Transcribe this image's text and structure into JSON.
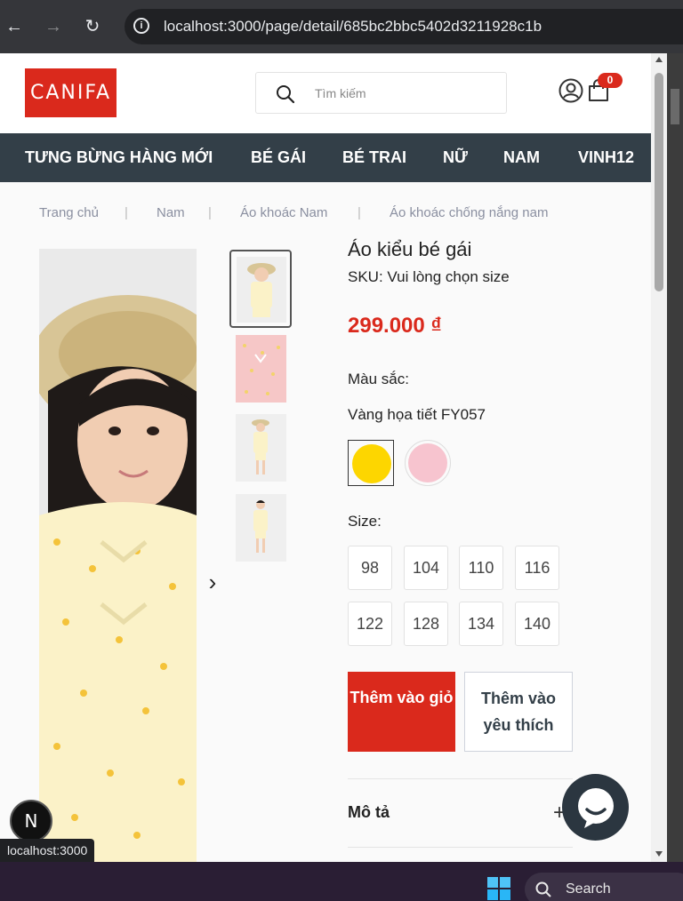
{
  "browser": {
    "url": "localhost:3000/page/detail/685bc2bbc5402d3211928c1b",
    "status_url": "localhost:3000"
  },
  "header": {
    "logo": "CANIFA",
    "search_placeholder": "Tìm kiếm",
    "cart_count": "0"
  },
  "nav": {
    "items": [
      "TƯNG BỪNG HÀNG MỚI",
      "BÉ GÁI",
      "BÉ TRAI",
      "NỮ",
      "NAM",
      "VINH12"
    ]
  },
  "breadcrumb": [
    "Trang chủ",
    "Nam",
    "Áo khoác Nam",
    "Áo khoác chống nắng nam"
  ],
  "product": {
    "title": "Áo kiểu bé gái",
    "sku": "SKU: Vui lòng chọn size",
    "price": "299.000 ₫",
    "color_label": "Màu sắc:",
    "color_name": "Vàng họa tiết FY057",
    "colors": [
      "#fdd600",
      "#f7c4cf"
    ],
    "size_label": "Size:",
    "sizes": [
      "98",
      "104",
      "110",
      "116",
      "122",
      "128",
      "134",
      "140"
    ],
    "add_to_cart": "Thêm vào giỏ",
    "add_to_wishlist": "Thêm vào yêu thích",
    "description_label": "Mô tả",
    "description_toggle": "+"
  },
  "overlay": {
    "next_badge": "N"
  },
  "taskbar": {
    "search_label": "Search"
  },
  "theme": {
    "brand_red": "#da291c",
    "nav_bg": "#333f48"
  }
}
